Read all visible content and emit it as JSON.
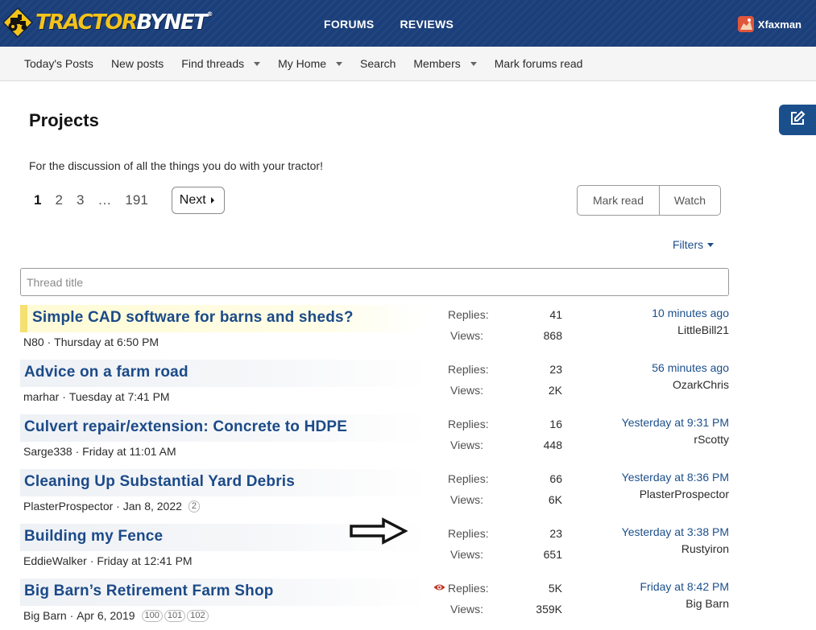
{
  "brand": {
    "logo_part1": "TRACTOR",
    "logo_part2": "BYNET",
    "logo_mark": "®",
    "logo_icon": "tractor-icon"
  },
  "topnav": [
    "FORUMS",
    "REVIEWS"
  ],
  "user": {
    "name": "Xfaxman",
    "avatar_color": "#e0563b"
  },
  "subnav": [
    {
      "label": "Today's Posts",
      "dropdown": false
    },
    {
      "label": "New posts",
      "dropdown": false
    },
    {
      "label": "Find threads",
      "dropdown": true
    },
    {
      "label": "My Home",
      "dropdown": true
    },
    {
      "label": "Search",
      "dropdown": false
    },
    {
      "label": "Members",
      "dropdown": true
    },
    {
      "label": "Mark forums read",
      "dropdown": false
    }
  ],
  "page": {
    "title": "Projects",
    "description": "For the discussion of all the things you do with your tractor!"
  },
  "pagination": {
    "pages": [
      "1",
      "2",
      "3",
      "…",
      "191"
    ],
    "current": "1",
    "next_label": "Next"
  },
  "actions": {
    "mark_read": "Mark read",
    "watch": "Watch",
    "filters": "Filters"
  },
  "search": {
    "placeholder": "Thread title",
    "value": ""
  },
  "labels": {
    "replies": "Replies:",
    "views": "Views:"
  },
  "threads": [
    {
      "title": "Simple CAD software for barns and sheds?",
      "author": "N80",
      "date": "Thursday at 6:50 PM",
      "pages": [],
      "replies": "41",
      "views": "868",
      "last_time": "10 minutes ago",
      "last_user": "LittleBill21",
      "highlight": true,
      "watched": false
    },
    {
      "title": "Advice on a farm road",
      "author": "marhar",
      "date": "Tuesday at 7:41 PM",
      "pages": [],
      "replies": "23",
      "views": "2K",
      "last_time": "56 minutes ago",
      "last_user": "OzarkChris",
      "highlight": false,
      "watched": false
    },
    {
      "title": "Culvert repair/extension: Concrete to HDPE",
      "author": "Sarge338",
      "date": "Friday at 11:01 AM",
      "pages": [],
      "replies": "16",
      "views": "448",
      "last_time": "Yesterday at 9:31 PM",
      "last_user": "rScotty",
      "highlight": false,
      "watched": false
    },
    {
      "title": "Cleaning Up Substantial Yard Debris",
      "author": "PlasterProspector",
      "date": "Jan 8, 2022",
      "pages": [
        "2"
      ],
      "replies": "66",
      "views": "6K",
      "last_time": "Yesterday at 8:36 PM",
      "last_user": "PlasterProspector",
      "highlight": false,
      "watched": false
    },
    {
      "title": "Building my Fence",
      "author": "EddieWalker",
      "date": "Friday at 12:41 PM",
      "pages": [],
      "replies": "23",
      "views": "651",
      "last_time": "Yesterday at 3:38 PM",
      "last_user": "Rustyiron",
      "highlight": false,
      "watched": false
    },
    {
      "title": "Big Barn’s Retirement Farm Shop",
      "author": "Big Barn",
      "date": "Apr 6, 2019",
      "pages": [
        "100",
        "101",
        "102"
      ],
      "replies": "5K",
      "views": "359K",
      "last_time": "Friday at 8:42 PM",
      "last_user": "Big Barn",
      "highlight": false,
      "watched": true
    }
  ]
}
